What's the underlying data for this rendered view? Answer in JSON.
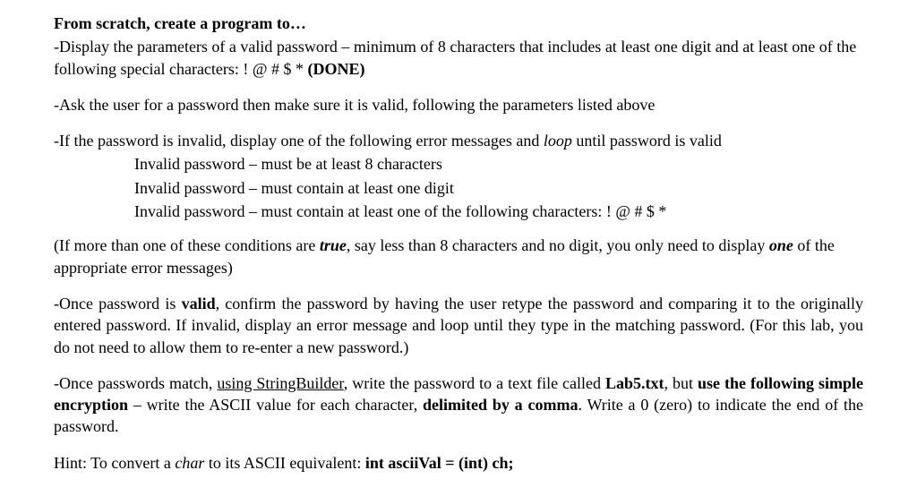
{
  "heading": "From scratch, create a program to…",
  "p1_a": "-Display the parameters of a valid password – minimum of 8 characters that includes at least one digit and at least one of the following special characters: ! @ # $ * ",
  "p1_b": "(DONE)",
  "p2": "-Ask the user for a password then make sure it is valid, following the parameters listed above",
  "p3_intro": "-If the password is invalid, display one of the following error messages and ",
  "p3_loop": "loop",
  "p3_tail": " until password is valid",
  "err1": "Invalid password – must be at least 8 characters",
  "err2": "Invalid password – must contain at least one digit",
  "err3": "Invalid password – must contain at least one of the following characters: ! @ # $ *",
  "p4_a": "(If more than one of these conditions are ",
  "p4_true": "true",
  "p4_b": ", say less than 8 characters and no digit, you only need to display ",
  "p4_one": "one",
  "p4_c": " of the appropriate error messages)",
  "p5_a": "-Once password is ",
  "p5_valid": "valid",
  "p5_b": ", confirm the password by having the user retype the password and comparing it to the originally entered password. If invalid, display an error message and loop until they type in the matching password. (For this lab, you do not need to allow them to re-enter a new password.)",
  "p6_a": "-Once passwords match, ",
  "p6_sb": "using StringBuilder",
  "p6_b": ", write the password to a text file called ",
  "p6_file": "Lab5.txt",
  "p6_c": ", but ",
  "p6_d": "use the following simple encryption",
  "p6_e": " – write the ASCII value for each character, ",
  "p6_f": "delimited by a comma",
  "p6_g": ". Write a 0 (zero) to indicate the end of the password.",
  "hint_a": "Hint: To convert a ",
  "hint_char": "char",
  "hint_b": " to its ASCII equivalent: ",
  "hint_code": "int asciiVal = (int) ch;"
}
